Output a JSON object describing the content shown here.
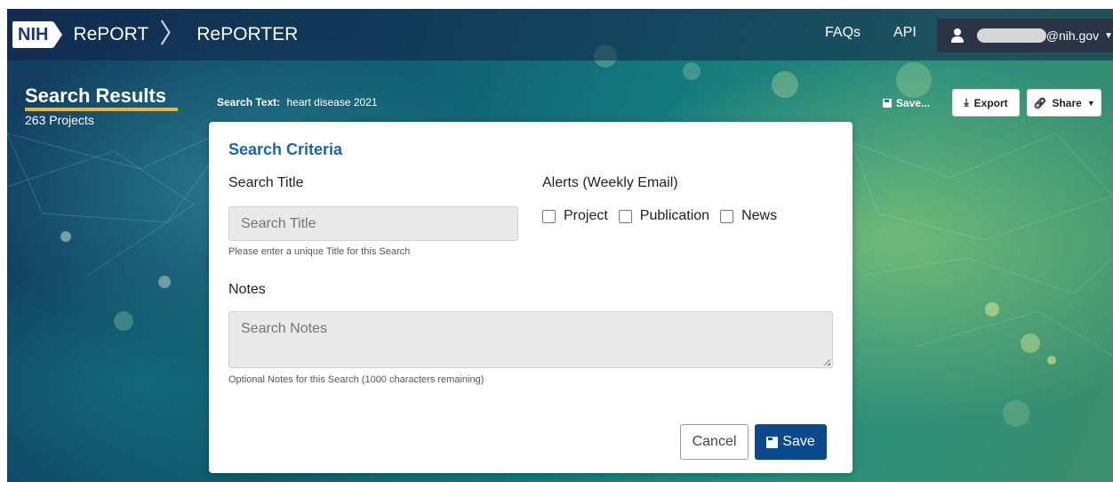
{
  "navbar": {
    "logo_text": "NIH",
    "brand": "RePORT",
    "separator": "〉",
    "product": "RePORTER",
    "links": {
      "faqs": "FAQs",
      "api": "API"
    },
    "user_email": "@nih.gov"
  },
  "results": {
    "title": "Search Results",
    "count": "263 Projects",
    "search_text_label": "Search Text:",
    "search_text_value": "heart disease 2021",
    "save_link": "Save...",
    "export_label": "Export",
    "share_label": "Share"
  },
  "modal": {
    "title": "Search Criteria",
    "search_title_label": "Search Title",
    "search_title_placeholder": "Search Title",
    "search_title_hint": "Please enter a unique Title for this Search",
    "alerts_label": "Alerts (Weekly Email)",
    "alert_options": [
      "Project",
      "Publication",
      "News"
    ],
    "notes_label": "Notes",
    "notes_placeholder": "Search Notes",
    "notes_hint": "Optional Notes for this Search (1000 characters remaining)",
    "cancel_label": "Cancel",
    "save_label": "Save"
  },
  "colors": {
    "navbar_bg": "#1b2a55",
    "accent_underline": "#f0b429",
    "primary_button": "#0a4a8c",
    "card_title": "#1a66a8"
  }
}
